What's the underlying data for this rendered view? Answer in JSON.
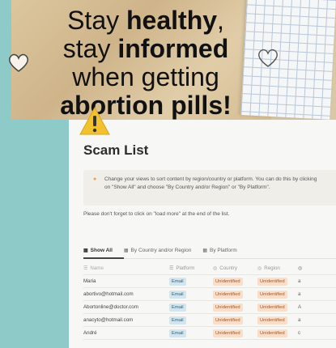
{
  "banner": {
    "line1_normal": "Stay ",
    "line1_bold": "healthy",
    "line1_tail": ",",
    "line2_normal": "stay ",
    "line2_bold": "informed",
    "line3": "when getting",
    "line4": "abortion pills!"
  },
  "page": {
    "title": "Scam List",
    "callout_line1": "Change your views to sort content by region/country or platform. You can do this by clicking",
    "callout_line2": "on \"Show All\" and choose  \"By Country and/or Region\" or \"By Platform\".",
    "note": "Please don't forget to click on \"load more\" at the end of the list."
  },
  "views": [
    {
      "label": "Show All",
      "active": true
    },
    {
      "label": "By Country and/or Region",
      "active": false
    },
    {
      "label": "By Platform",
      "active": false
    }
  ],
  "table": {
    "headers": [
      "Name",
      "Platform",
      "Country",
      "Region"
    ],
    "rows": [
      {
        "name": "Maria",
        "platform": "Email",
        "country": "Unidentified",
        "region": "Unidentified",
        "extra": "a"
      },
      {
        "name": "abortivo@hotmail.com",
        "platform": "Email",
        "country": "Unidentified",
        "region": "Unidentified",
        "extra": "a"
      },
      {
        "name": "Abortonline@doctor.com",
        "platform": "Email",
        "country": "Unidentified",
        "region": "Unidentified",
        "extra": "A"
      },
      {
        "name": "anacyto@hotmail.com",
        "platform": "Email",
        "country": "Unidentified",
        "region": "Unidentified",
        "extra": "a"
      },
      {
        "name": "André",
        "platform": "Email",
        "country": "Unidentified",
        "region": "Unidentified",
        "extra": "c"
      }
    ]
  },
  "colors": {
    "background": "#8ecbc8",
    "email_tag": "#d3e5ef",
    "unidentified_tag": "#fadec9",
    "warning": "#f2c12e"
  }
}
